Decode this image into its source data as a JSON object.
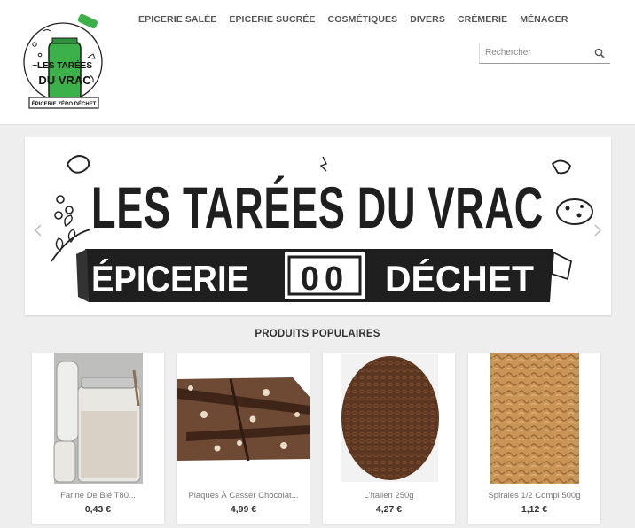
{
  "nav": {
    "items": [
      "EPICERIE SALÉE",
      "EPICERIE SUCRÉE",
      "COSMÉTIQUES",
      "DIVERS",
      "CRÉMERIE",
      "MÉNAGER"
    ]
  },
  "search": {
    "placeholder": "Rechercher",
    "value": ""
  },
  "logo": {
    "line1": "LES TARÉES",
    "line2": "DU VRAC",
    "ribbon": "ÉPICERIE ZÉRO DÉCHET"
  },
  "banner": {
    "title": "LES TARÉES DU VRAC",
    "subtitle_left": "ÉPICERIE",
    "subtitle_mid": "00",
    "subtitle_right": "DÉCHET"
  },
  "section": {
    "title": "PRODUITS POPULAIRES"
  },
  "products": [
    {
      "name": "Farine De Blé T80...",
      "price": "0,43 €"
    },
    {
      "name": "Plaques À Casser Chocolat...",
      "price": "4,99 €"
    },
    {
      "name": "L'Italien 250g",
      "price": "4,27 €"
    },
    {
      "name": "Spirales 1/2 Compl 500g",
      "price": "1,12 €"
    }
  ],
  "colors": {
    "accent_green": "#3cb14a",
    "banner_dark": "#1f1f1f"
  }
}
